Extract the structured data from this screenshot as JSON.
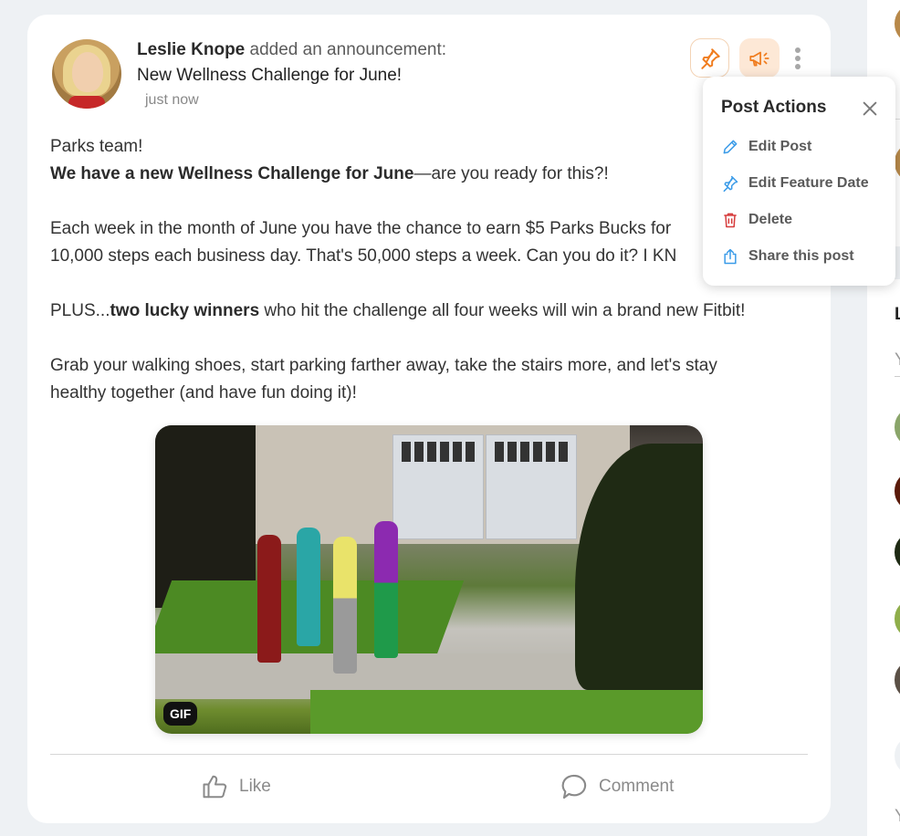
{
  "post": {
    "author": "Leslie Knope",
    "action_text": " added an announcement:",
    "title": "New Wellness Challenge for June!",
    "timestamp": "just now",
    "body": {
      "line1": "Parks team!",
      "line2_bold": "We have a new Wellness Challenge for June",
      "line2_rest": "—are you ready for this?!",
      "line3": "Each week in the month of June you have the chance to earn $5 Parks Bucks for",
      "line4": "10,000 steps each business day. That's 50,000 steps a week. Can you do it? I KN",
      "line5_prefix": "PLUS...",
      "line5_bold": "two lucky winners",
      "line5_rest": " who hit the challenge all four weeks will win a brand new Fitbit!",
      "line6": "Grab your walking shoes, start parking farther away, take the stairs more, and let's stay",
      "line7": "healthy together (and have fun doing it)!"
    },
    "media_badge": "GIF",
    "actions": {
      "like": "Like",
      "comment": "Comment"
    },
    "header_buttons": {
      "pin": "pin-icon",
      "announce": "megaphone-icon",
      "more": "kebab-icon"
    },
    "accent_color": "#f07c1e"
  },
  "popup": {
    "title": "Post Actions",
    "items": [
      {
        "label": "Edit Post",
        "icon": "pencil-icon",
        "color": "#3a9be8"
      },
      {
        "label": "Edit Feature Date",
        "icon": "pin-icon",
        "color": "#3a9be8"
      },
      {
        "label": "Delete",
        "icon": "trash-icon",
        "color": "#d63b3b"
      },
      {
        "label": "Share this post",
        "icon": "share-icon",
        "color": "#3a9be8"
      }
    ]
  },
  "right_panel": {
    "heading_partial": "L",
    "text_partial_1": "Y",
    "text_partial_2": "Y"
  }
}
